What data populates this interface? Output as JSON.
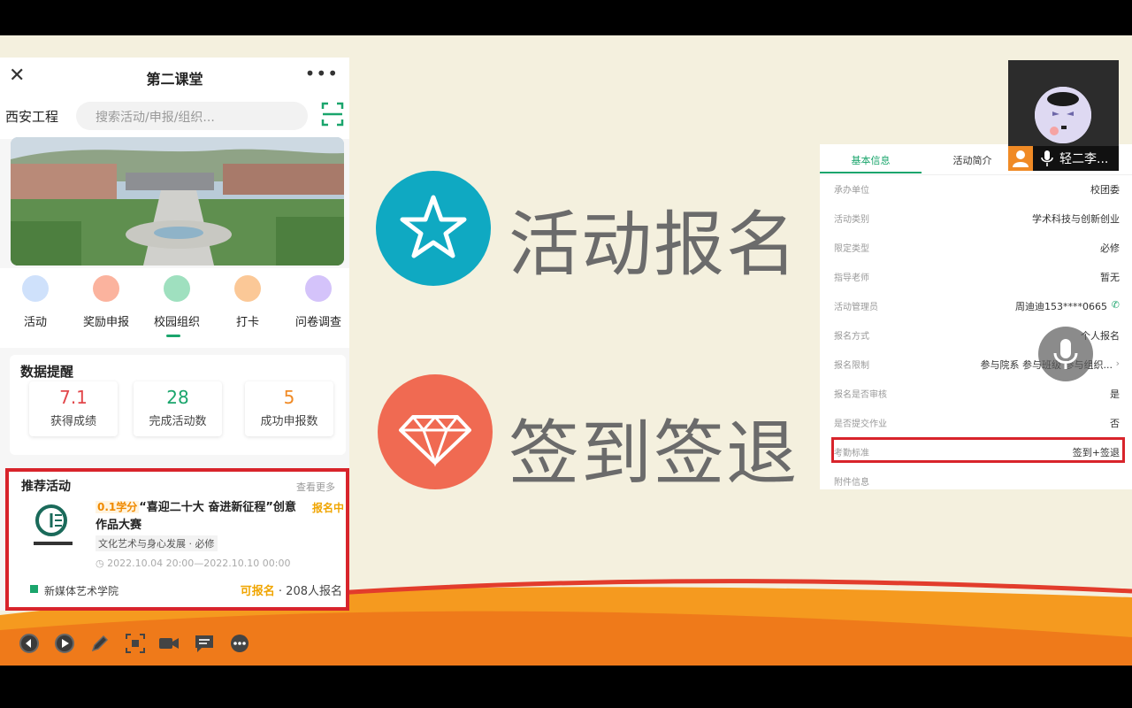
{
  "phone": {
    "close_icon": "close-icon",
    "title": "第二课堂",
    "more_icon": "more-icon",
    "city": "西安工程",
    "search_placeholder": "搜索活动/申报/组织...",
    "nav": [
      {
        "label": "活动",
        "icon": "star-icon",
        "color": "#6fa8f0"
      },
      {
        "label": "奖励申报",
        "icon": "medal-icon",
        "color": "#f47a55"
      },
      {
        "label": "校园组织",
        "icon": "people-icon",
        "color": "#3dbf7f"
      },
      {
        "label": "打卡",
        "icon": "hand-icon",
        "color": "#f59a4a"
      },
      {
        "label": "问卷调查",
        "icon": "form-icon",
        "color": "#a47ef0"
      }
    ],
    "stats": {
      "title": "数据提醒",
      "items": [
        {
          "value": "7.1",
          "label": "获得成绩",
          "color": "#e2474b"
        },
        {
          "value": "28",
          "label": "完成活动数",
          "color": "#1aa56c"
        },
        {
          "value": "5",
          "label": "成功申报数",
          "color": "#f08a25"
        }
      ]
    },
    "recommend": {
      "title": "推荐活动",
      "more": "查看更多",
      "tag": "0.1学分",
      "name": "“喜迎二十大 奋进新征程”创意作品大赛",
      "status": "报名中",
      "category": "文化艺术与身心发展 · 必修",
      "time": "2022.10.04 20:00—2022.10.10 00:00",
      "org": "新媒体艺术学院",
      "available": "可报名",
      "count": "· 208人报名"
    }
  },
  "slide": {
    "item1": {
      "text": "活动报名",
      "icon": "star-icon",
      "color": "#0fa9c2"
    },
    "item2": {
      "text": "签到签退",
      "icon": "diamond-icon",
      "color": "#f06a52"
    }
  },
  "info": {
    "tabs": [
      "基本信息",
      "活动简介"
    ],
    "rows": [
      {
        "key": "承办单位",
        "value": "校团委"
      },
      {
        "key": "活动类别",
        "value": "学术科技与创新创业"
      },
      {
        "key": "限定类型",
        "value": "必修"
      },
      {
        "key": "指导老师",
        "value": "暂无"
      },
      {
        "key": "活动管理员",
        "value": "周迪迪153****0665"
      },
      {
        "key": "报名方式",
        "value": "个人报名"
      },
      {
        "key": "报名限制",
        "value": "参与院系 参与班级 参与组织..."
      },
      {
        "key": "报名是否审核",
        "value": "是"
      },
      {
        "key": "是否提交作业",
        "value": "否"
      },
      {
        "key": "考勤标准",
        "value": "签到+签退"
      },
      {
        "key": "附件信息",
        "value": ""
      }
    ]
  },
  "video": {
    "name": "轻二李..."
  },
  "toolbar": [
    "back-icon",
    "play-icon",
    "pen-icon",
    "screenshot-icon",
    "camera-icon",
    "chat-icon",
    "more-icon"
  ]
}
